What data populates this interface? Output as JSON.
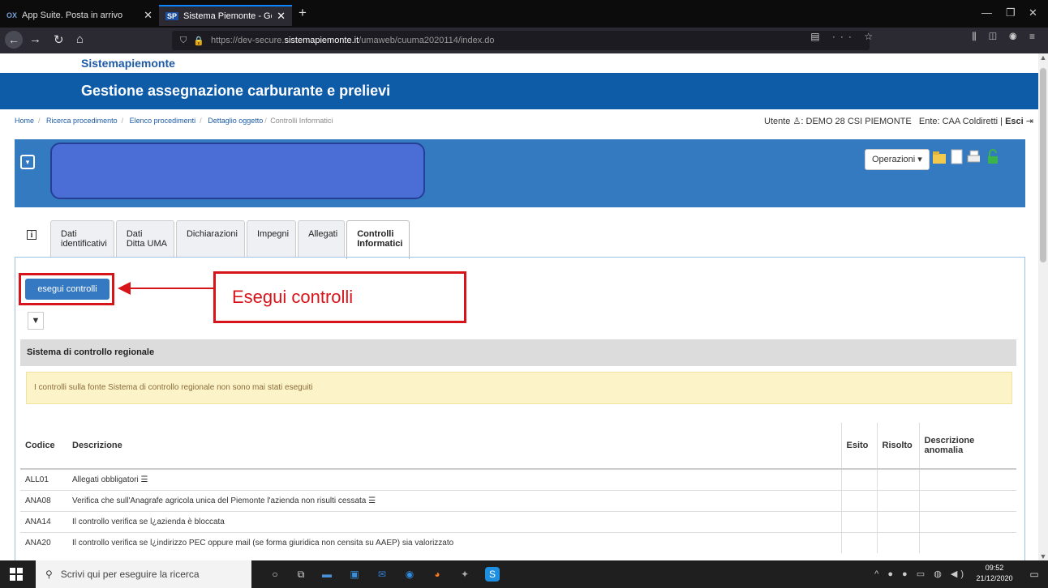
{
  "browser": {
    "tabs": [
      {
        "favicon": "OX",
        "title": "App Suite. Posta in arrivo"
      },
      {
        "favicon": "SP",
        "title": "Sistema Piemonte - Gestione a"
      }
    ],
    "url_prefix": "https://dev-secure.",
    "url_host": "sistemapiemonte.it",
    "url_path": "/umaweb/cuuma2020114/index.do"
  },
  "site": {
    "brand": "Sistemapiemonte",
    "title": "Gestione assegnazione carburante e prelievi"
  },
  "breadcrumb": {
    "items": [
      "Home",
      "Ricerca procedimento",
      "Elenco procedimenti",
      "Dettaglio oggetto"
    ],
    "current": "Controlli Informatici"
  },
  "user": {
    "utente_label": "Utente",
    "name": "DEMO 28 CSI PIEMONTE",
    "ente": "Ente: CAA Coldiretti",
    "logout": "Esci"
  },
  "panel": {
    "operations_label": "Operazioni"
  },
  "tabs": [
    {
      "line1": "Dati",
      "line2": "identificativi"
    },
    {
      "line1": "Dati",
      "line2": "Ditta UMA"
    },
    {
      "line1": "Dichiarazioni",
      "line2": ""
    },
    {
      "line1": "Impegni",
      "line2": ""
    },
    {
      "line1": "Allegati",
      "line2": ""
    },
    {
      "line1": "Controlli",
      "line2": "Informatici"
    }
  ],
  "controls": {
    "run_button": "esegui controlli",
    "annotation": "Esegui controlli",
    "section_title": "Sistema di controllo regionale",
    "warning": "I controlli sulla fonte Sistema di controllo regionale non sono mai stati eseguiti",
    "columns": {
      "codice": "Codice",
      "descrizione": "Descrizione",
      "esito": "Esito",
      "risolto": "Risolto",
      "descr_anomalia_1": "Descrizione",
      "descr_anomalia_2": "anomalia"
    },
    "rows": [
      {
        "code": "ALL01",
        "desc": "Allegati obbligatori",
        "list_icon": true
      },
      {
        "code": "ANA08",
        "desc": "Verifica che sull'Anagrafe agricola unica del Piemonte l'azienda non risulti cessata",
        "list_icon": true
      },
      {
        "code": "ANA14",
        "desc": "Il controllo verifica se l¿azienda è bloccata",
        "list_icon": false
      },
      {
        "code": "ANA20",
        "desc": "Il controllo verifica se l¿indirizzo PEC oppure mail (se forma giuridica non censita su AAEP) sia valorizzato",
        "list_icon": false
      }
    ]
  },
  "taskbar": {
    "search_placeholder": "Scrivi qui per eseguire la ricerca",
    "time": "09:52",
    "date": "21/12/2020"
  },
  "icons": {
    "home": "house-icon",
    "lock": "lock-icon",
    "user": "user-icon",
    "logout": "logout-icon",
    "filter": "filter-icon",
    "info": "info-icon"
  },
  "colors": {
    "header_blue": "#0e5ba8",
    "panel_blue": "#347ac0",
    "button_blue": "#3679c3",
    "annotation_red": "#d8141b",
    "warning_bg": "#fcf3c8"
  }
}
